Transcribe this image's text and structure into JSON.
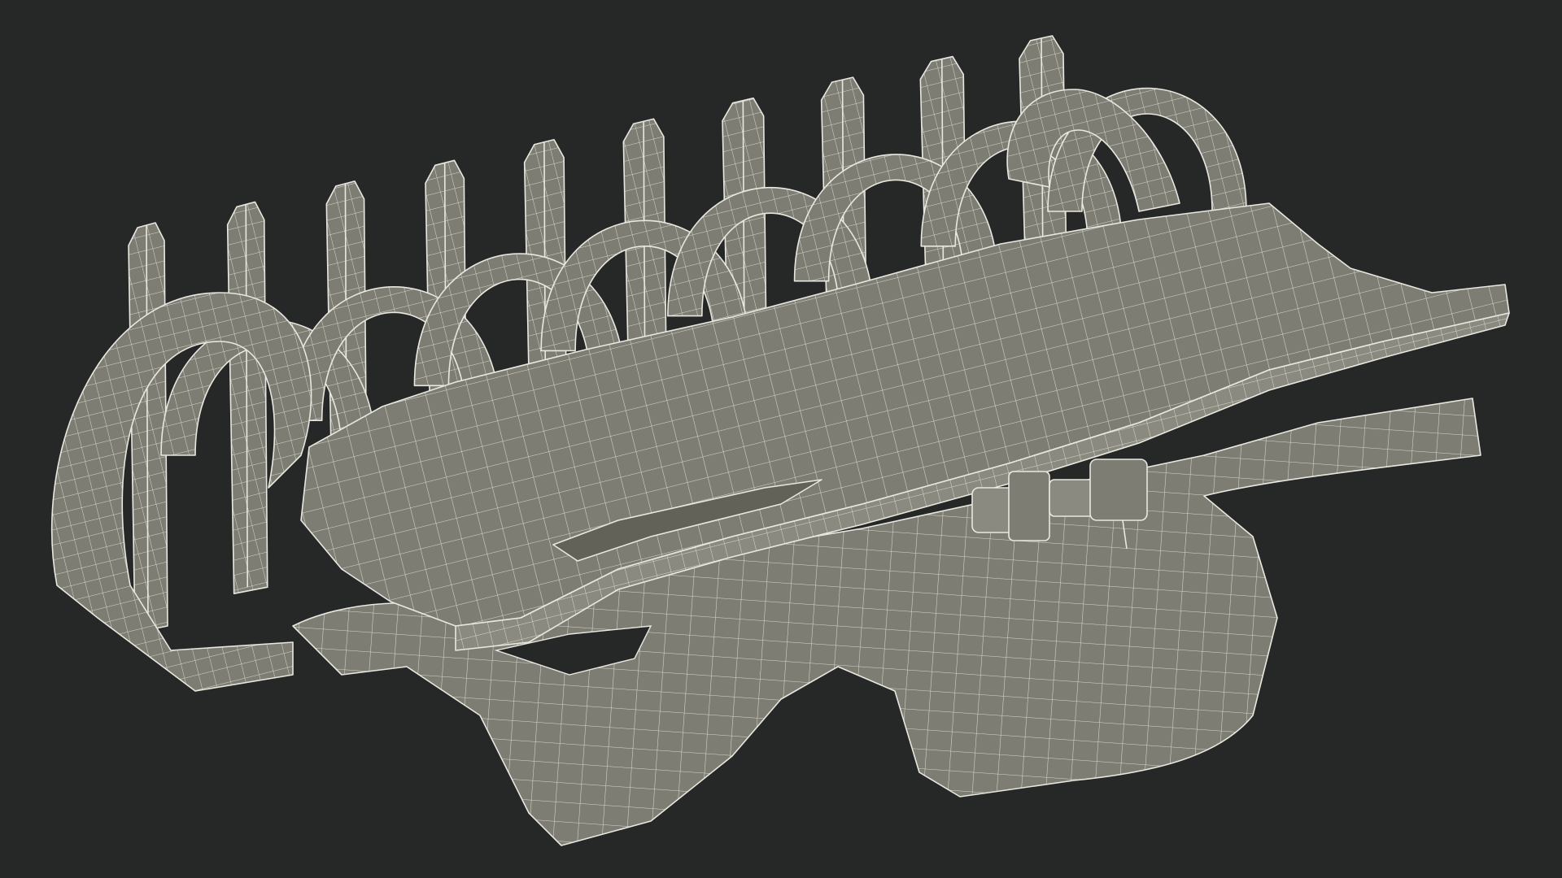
{
  "render": {
    "background": "#262727",
    "surface": "#7d7d73",
    "surface_light": "#8a8a80",
    "surface_dark": "#626259",
    "wire": "#e8e8e0"
  },
  "model": {
    "tooth_count": 10,
    "arch_count": 8
  }
}
